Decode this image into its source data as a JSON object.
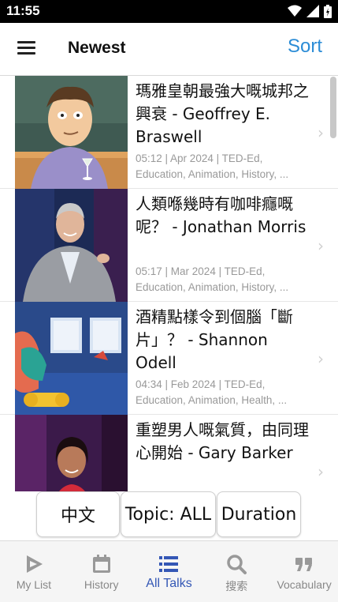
{
  "status_bar": {
    "time": "11:55"
  },
  "app_bar": {
    "title": "Newest",
    "sort_label": "Sort"
  },
  "talks": [
    {
      "title": "瑪雅皇朝最強大嘅城邦之興衰 - Geoffrey E. Braswell",
      "duration": "05:12",
      "date": "Apr 2024",
      "meta_line1": "05:12 | Apr 2024 | TED-Ed,",
      "meta_line2": "Education, Animation, History, ..."
    },
    {
      "title": "人類喺幾時有咖啡癮嘅呢？ - Jonathan Morris",
      "duration": "05:17",
      "date": "Mar 2024",
      "meta_line1": "05:17 | Mar 2024 | TED-Ed,",
      "meta_line2": "Education, Animation, History, ..."
    },
    {
      "title": "酒精點樣令到個腦「斷片」？ - Shannon Odell",
      "duration": "04:34",
      "date": "Feb 2024",
      "meta_line1": "04:34 | Feb 2024 | TED-Ed,",
      "meta_line2": "Education, Animation, Health, ..."
    },
    {
      "title": "重塑男人嘅氣質，由同理心開始 - Gary Barker",
      "meta_line1": "",
      "meta_line2": ""
    }
  ],
  "filters": {
    "language": "中文",
    "topic": "Topic: ALL",
    "duration": "Duration"
  },
  "bottom_nav": [
    {
      "label": "My List",
      "icon": "play-icon",
      "active": false
    },
    {
      "label": "History",
      "icon": "calendar-icon",
      "active": false
    },
    {
      "label": "All Talks",
      "icon": "list-icon",
      "active": true
    },
    {
      "label": "搜索",
      "icon": "search-icon",
      "active": false
    },
    {
      "label": "Vocabulary",
      "icon": "quote-icon",
      "active": false
    }
  ],
  "colors": {
    "accent": "#2b8cd6",
    "nav_active": "#3457b5",
    "nav_inactive": "#888888"
  }
}
